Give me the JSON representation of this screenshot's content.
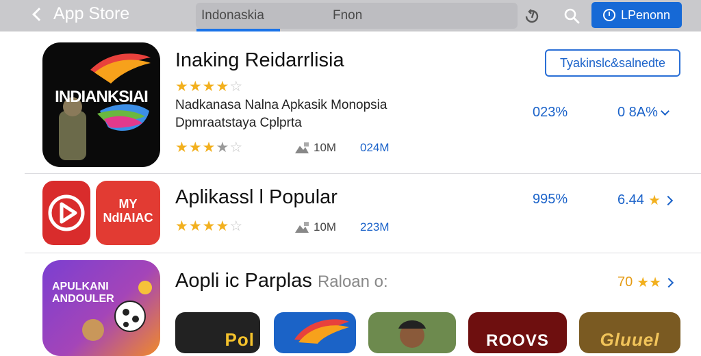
{
  "nav": {
    "back_label": "App Store",
    "tabs": [
      {
        "label": "Indonaskia"
      },
      {
        "label": "Fnon"
      }
    ],
    "primary_button": "LPenonn"
  },
  "apps": [
    {
      "icon_text": "INDIANKSIAI",
      "title": "Inaking Reidarrlisia",
      "rating_stars": 4.5,
      "description_line1": "Nadkanasa Nalna  Apkasik Monopsia",
      "description_line2": "Dpmraatstaya Cplprta",
      "sub_rating_stars": 3.5,
      "size": "10M",
      "downloads": "024M",
      "percent": "023%",
      "action_label": "Tyakinslc&salnedte",
      "score": "0 8A%"
    },
    {
      "icon_text_a": "",
      "icon_text_b": "MY NdIAIAC",
      "title": "Aplikassl l Popular",
      "rating_stars": 4.5,
      "size": "10M",
      "downloads": "223M",
      "percent": "995%",
      "score": "6.44"
    },
    {
      "icon_text": "APULKANI ANDOULER",
      "title": "Aopli ic Parplas",
      "title_suffix": "Raloan o:",
      "score": "70"
    }
  ],
  "thumbnails": [
    {
      "label": "Pol"
    },
    {
      "label": ""
    },
    {
      "label": ""
    },
    {
      "label": "ROOVS"
    },
    {
      "label": "Gluuel"
    }
  ],
  "colors": {
    "accent": "#1669d6",
    "star": "#f2b01e",
    "nav_bg": "#c9c9cc"
  }
}
